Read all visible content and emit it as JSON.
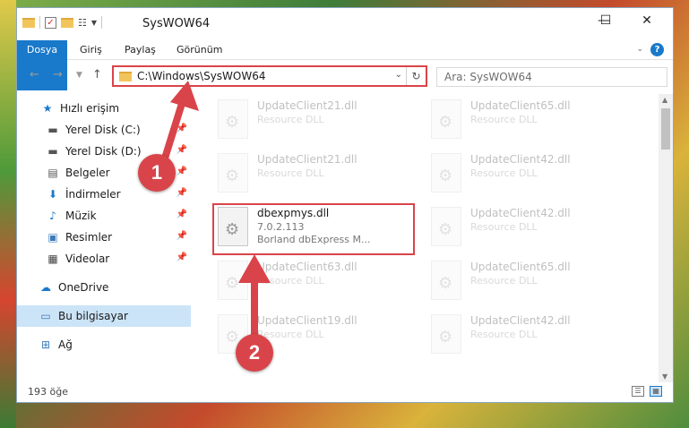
{
  "titlebar": {
    "title": "SysWOW64",
    "minimize_glyph": "—",
    "maximize_glyph": "☐",
    "close_glyph": "✕"
  },
  "ribbon": {
    "tabs": [
      "Dosya",
      "Giriş",
      "Paylaş",
      "Görünüm"
    ],
    "help_glyph": "?"
  },
  "address": {
    "path": "C:\\Windows\\SysWOW64"
  },
  "search": {
    "placeholder": "Ara: SysWOW64"
  },
  "sidebar": {
    "items": [
      {
        "label": "Hızlı erişim",
        "icon": "star-icon"
      },
      {
        "label": "Yerel Disk (C:)",
        "icon": "drive-icon"
      },
      {
        "label": "Yerel Disk (D:)",
        "icon": "drive-icon"
      },
      {
        "label": "Belgeler",
        "icon": "documents-icon"
      },
      {
        "label": "İndirmeler",
        "icon": "download-icon"
      },
      {
        "label": "Müzik",
        "icon": "music-icon"
      },
      {
        "label": "Resimler",
        "icon": "pictures-icon"
      },
      {
        "label": "Videolar",
        "icon": "video-icon"
      },
      {
        "label": "OneDrive",
        "icon": "cloud-icon"
      },
      {
        "label": "Bu bilgisayar",
        "icon": "computer-icon"
      },
      {
        "label": "Ağ",
        "icon": "network-icon"
      }
    ]
  },
  "files": [
    {
      "name": "UpdateClient21.dll",
      "line2": "Resource DLL",
      "line3": ""
    },
    {
      "name": "UpdateClient65.dll",
      "line2": "Resource DLL",
      "line3": ""
    },
    {
      "name": "UpdateClient21.dll",
      "line2": "Resource DLL",
      "line3": ""
    },
    {
      "name": "UpdateClient42.dll",
      "line2": "Resource DLL",
      "line3": ""
    },
    {
      "name": "dbexpmys.dll",
      "line2": "7.0.2.113",
      "line3": "Borland dbExpress M..."
    },
    {
      "name": "UpdateClient42.dll",
      "line2": "Resource DLL",
      "line3": ""
    },
    {
      "name": "UpdateClient63.dll",
      "line2": "Resource DLL",
      "line3": ""
    },
    {
      "name": "UpdateClient65.dll",
      "line2": "Resource DLL",
      "line3": ""
    },
    {
      "name": "UpdateClient19.dll",
      "line2": "Resource DLL",
      "line3": ""
    },
    {
      "name": "UpdateClient42.dll",
      "line2": "Resource DLL",
      "line3": ""
    }
  ],
  "status": {
    "count": "193 öğe"
  },
  "callouts": {
    "one": "1",
    "two": "2"
  },
  "colors": {
    "accent": "#1979ca",
    "highlight": "#d9444a",
    "selected": "#cce4f7"
  }
}
